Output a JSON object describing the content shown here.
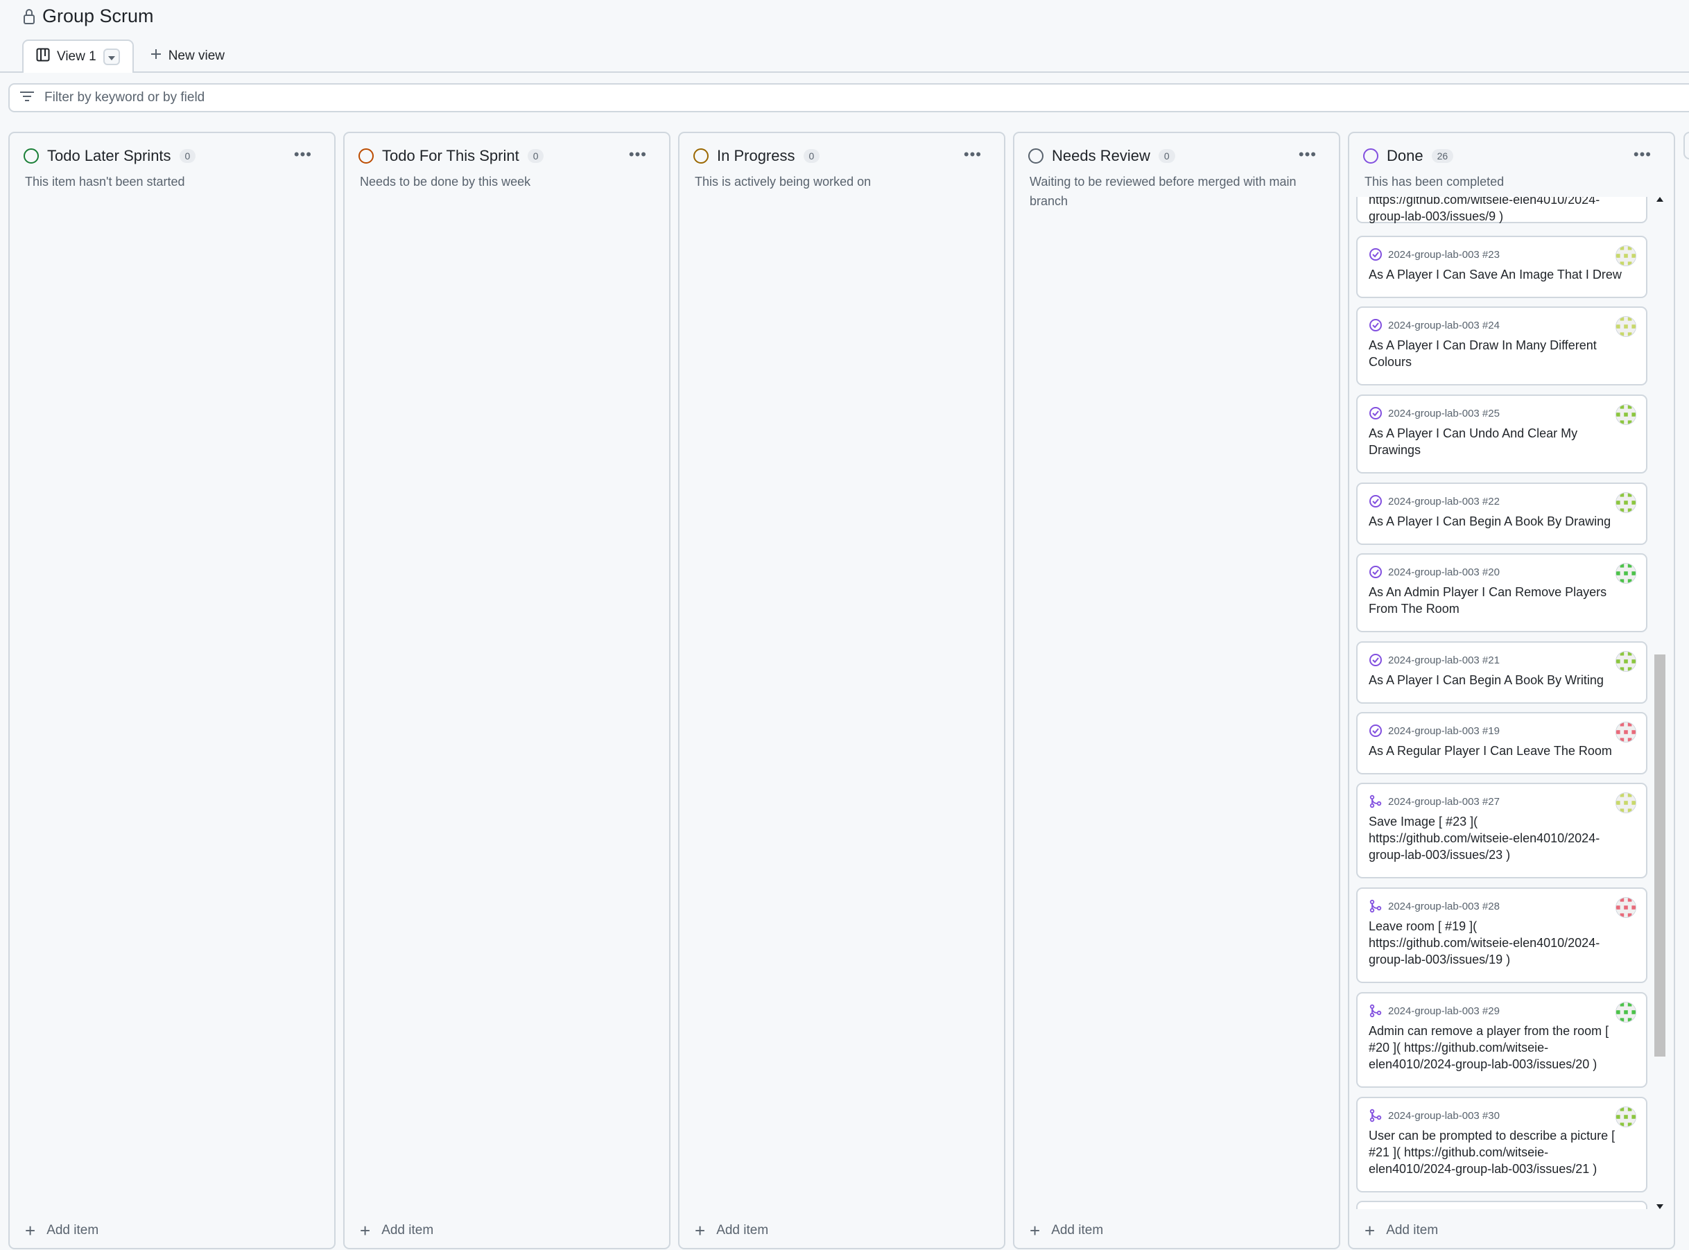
{
  "header": {
    "title": "Group Scrum",
    "tabs": [
      {
        "label": "View 1"
      },
      {
        "label": "New view"
      }
    ]
  },
  "filter": {
    "placeholder": "Filter by keyword or by field"
  },
  "colors": {
    "todo_later": "#1a7f37",
    "todo_sprint": "#bc4c00",
    "in_progress": "#9a6700",
    "needs_review": "#59636e",
    "done": "#8250df"
  },
  "columns": [
    {
      "name": "Todo Later Sprints",
      "count": "0",
      "desc": "This item hasn't been started",
      "add": "Add item"
    },
    {
      "name": "Todo For This Sprint",
      "count": "0",
      "desc": "Needs to be done by this week",
      "add": "Add item"
    },
    {
      "name": "In Progress",
      "count": "0",
      "desc": "This is actively being worked on",
      "add": "Add item"
    },
    {
      "name": "Needs Review",
      "count": "0",
      "desc": "Waiting to be reviewed before merged with main branch",
      "add": "Add item"
    },
    {
      "name": "Done",
      "count": "26",
      "desc": "This has been completed",
      "add": "Add item"
    }
  ],
  "done_cards": [
    {
      "type": "partial",
      "ref": "",
      "title": "https://github.com/witseie-elen4010/2024-group-lab-003/issues/9 )"
    },
    {
      "type": "issue",
      "ref": "2024-group-lab-003 #23",
      "title": "As A Player I Can Save An Image That I Drew"
    },
    {
      "type": "issue",
      "ref": "2024-group-lab-003 #24",
      "title": "As A Player I Can Draw In Many Different Colours"
    },
    {
      "type": "issue",
      "ref": "2024-group-lab-003 #25",
      "title": "As A Player I Can Undo And Clear My Drawings"
    },
    {
      "type": "issue",
      "ref": "2024-group-lab-003 #22",
      "title": "As A Player I Can Begin A Book By Drawing"
    },
    {
      "type": "issue",
      "ref": "2024-group-lab-003 #20",
      "title": "As An Admin Player I Can Remove Players From The Room"
    },
    {
      "type": "issue",
      "ref": "2024-group-lab-003 #21",
      "title": "As A Player I Can Begin A Book By Writing"
    },
    {
      "type": "issue",
      "ref": "2024-group-lab-003 #19",
      "title": "As A Regular Player I Can Leave The Room"
    },
    {
      "type": "pr",
      "ref": "2024-group-lab-003 #27",
      "title": "Save Image [ #23 ]( https://github.com/witseie-elen4010/2024-group-lab-003/issues/23 )"
    },
    {
      "type": "pr",
      "ref": "2024-group-lab-003 #28",
      "title": "Leave room [ #19 ]( https://github.com/witseie-elen4010/2024-group-lab-003/issues/19 )"
    },
    {
      "type": "pr",
      "ref": "2024-group-lab-003 #29",
      "title": "Admin can remove a player from the room [ #20 ]( https://github.com/witseie-elen4010/2024-group-lab-003/issues/20 )"
    },
    {
      "type": "pr",
      "ref": "2024-group-lab-003 #30",
      "title": "User can be prompted to describe a picture [ #21 ]( https://github.com/witseie-elen4010/2024-group-lab-003/issues/21 )"
    }
  ]
}
